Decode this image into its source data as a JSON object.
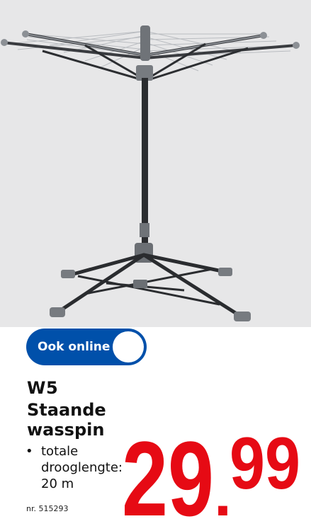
{
  "badge": {
    "label": "Ook online"
  },
  "product": {
    "brand": "W5",
    "name_line1": "Staande",
    "name_line2": "wasspin",
    "feature_bullet": "•",
    "feature_line1": "totale",
    "feature_line2": "drooglengte:",
    "feature_line3": "20 m",
    "article_number": "nr. 515293"
  },
  "price": {
    "whole": "29",
    "separator": ".",
    "cents": "99",
    "color": "#e60a14"
  },
  "colors": {
    "badge": "#0050aa",
    "photo_background": "#e7e7e8"
  }
}
